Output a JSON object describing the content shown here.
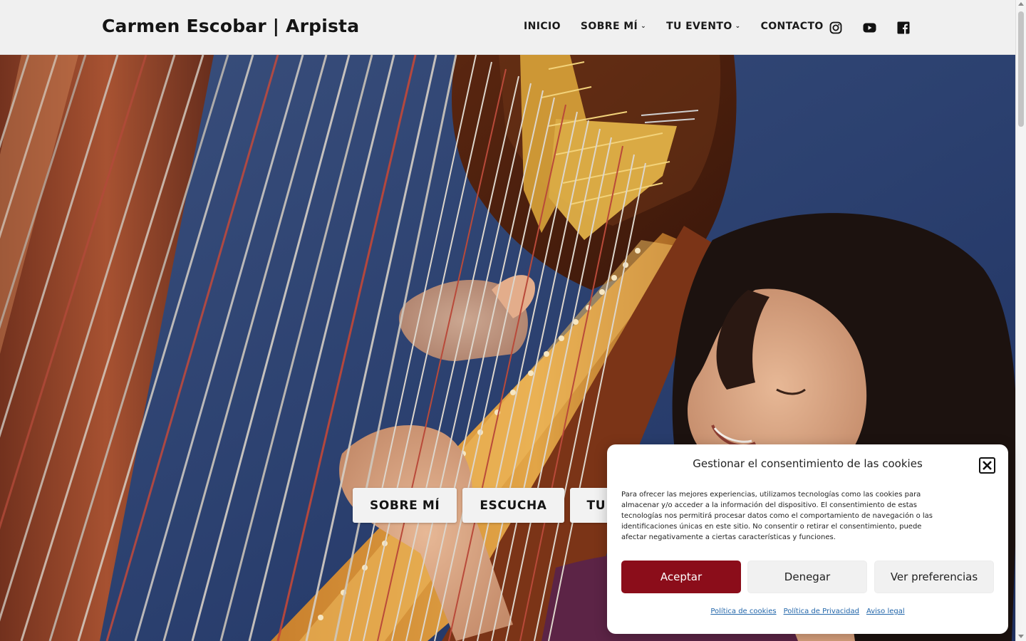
{
  "header": {
    "site_title": "Carmen Escobar | Arpista",
    "nav": [
      {
        "label": "INICIO",
        "has_dropdown": false
      },
      {
        "label": "SOBRE MÍ",
        "has_dropdown": true
      },
      {
        "label": "TU EVENTO",
        "has_dropdown": true
      },
      {
        "label": "CONTACTO",
        "has_dropdown": false
      }
    ],
    "social_icons": [
      "instagram-icon",
      "youtube-icon",
      "facebook-icon"
    ]
  },
  "hero": {
    "image_subject": "harpist playing a harp",
    "buttons": [
      "SOBRE MÍ",
      "ESCUCHA",
      "TU EVENTO"
    ]
  },
  "cookie_banner": {
    "title": "Gestionar el consentimiento de las cookies",
    "body": "Para ofrecer las mejores experiencias, utilizamos tecnologías como las cookies para almacenar y/o acceder a la información del dispositivo. El consentimiento de estas tecnologías nos permitirá procesar datos como el comportamiento de navegación o las identificaciones únicas en este sitio. No consentir o retirar el consentimiento, puede afectar negativamente a ciertas características y funciones.",
    "accept_label": "Aceptar",
    "deny_label": "Denegar",
    "preferences_label": "Ver preferencias",
    "links": [
      "Política de cookies",
      "Política de Privacidad",
      "Aviso legal"
    ],
    "accent_color": "#8b0d1a"
  }
}
